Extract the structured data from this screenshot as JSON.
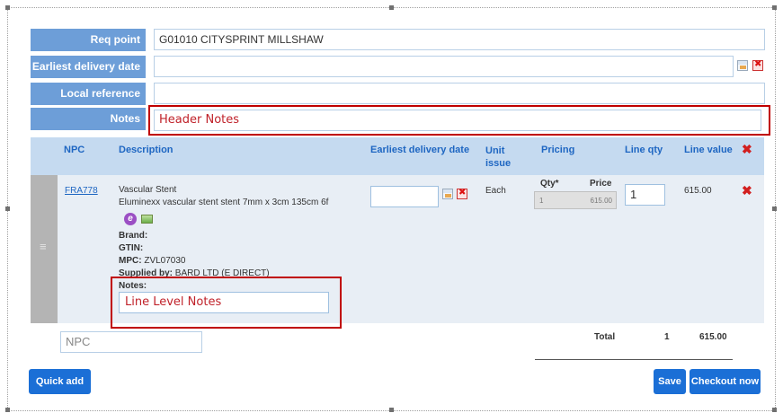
{
  "header": {
    "req_point_label": "Req point",
    "req_point_value": "G01010 CITYSPRINT MILLSHAW",
    "earliest_delivery_label": "Earliest delivery date",
    "earliest_delivery_value": "",
    "local_ref_label": "Local reference",
    "local_ref_value": "",
    "notes_label": "Notes",
    "notes_value": "Header Notes"
  },
  "table": {
    "columns": {
      "npc": "NPC",
      "description": "Description",
      "earliest_delivery": "Earliest delivery date",
      "unit_issue": "Unit issue",
      "pricing": "Pricing",
      "line_qty": "Line qty",
      "line_value": "Line value"
    },
    "rows": [
      {
        "npc": "FRA778",
        "title": "Vascular Stent",
        "subtitle": "Eluminexx vascular stent stent 7mm x 3cm 135cm 6f",
        "brand_label": "Brand:",
        "gtin_label": "GTIN:",
        "mpc_label": "MPC:",
        "mpc_value": "ZVL07030",
        "supplied_label": "Supplied by:",
        "supplied_value": "BARD LTD (E DIRECT)",
        "notes_label": "Notes:",
        "notes_value": "Line Level Notes",
        "unit": "Each",
        "qty_label": "Qty*",
        "price_label": "Price",
        "pricing_qty": "1",
        "pricing_price": "615.00",
        "line_qty": "1",
        "line_value": "615.00"
      }
    ],
    "npc_placeholder": "NPC",
    "total_label": "Total",
    "total_qty": "1",
    "total_value": "615.00"
  },
  "buttons": {
    "quick_add": "Quick add",
    "save": "Save",
    "checkout": "Checkout now"
  },
  "colors": {
    "accent": "#1b6fd6",
    "label_bg": "#6d9ed8",
    "header_bg": "#c5daf0",
    "highlight": "#c00000"
  }
}
